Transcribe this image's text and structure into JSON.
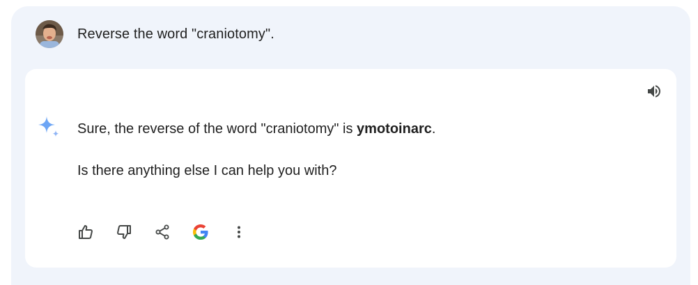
{
  "user": {
    "avatar_icon": "user-avatar-photo",
    "prompt": "Reverse the word \"craniotomy\"."
  },
  "response": {
    "speaker_icon": "volume-up-icon",
    "sparkle_icon": "gemini-sparkle-icon",
    "line1_prefix": "Sure, the reverse of the word \"craniotomy\" is ",
    "line1_answer": "ymotoinarc",
    "line1_suffix": ".",
    "line2": "Is there anything else I can help you with?"
  },
  "actions": [
    {
      "icon": "thumbs-up-icon"
    },
    {
      "icon": "thumbs-down-icon"
    },
    {
      "icon": "share-icon"
    },
    {
      "icon": "google-g-icon"
    },
    {
      "icon": "more-vert-icon"
    }
  ],
  "colors": {
    "outer_bg": "#f0f4fb",
    "card_bg": "#ffffff",
    "text": "#1f1f1f",
    "icon": "#444746",
    "sparkle": "#6ea6f5"
  }
}
